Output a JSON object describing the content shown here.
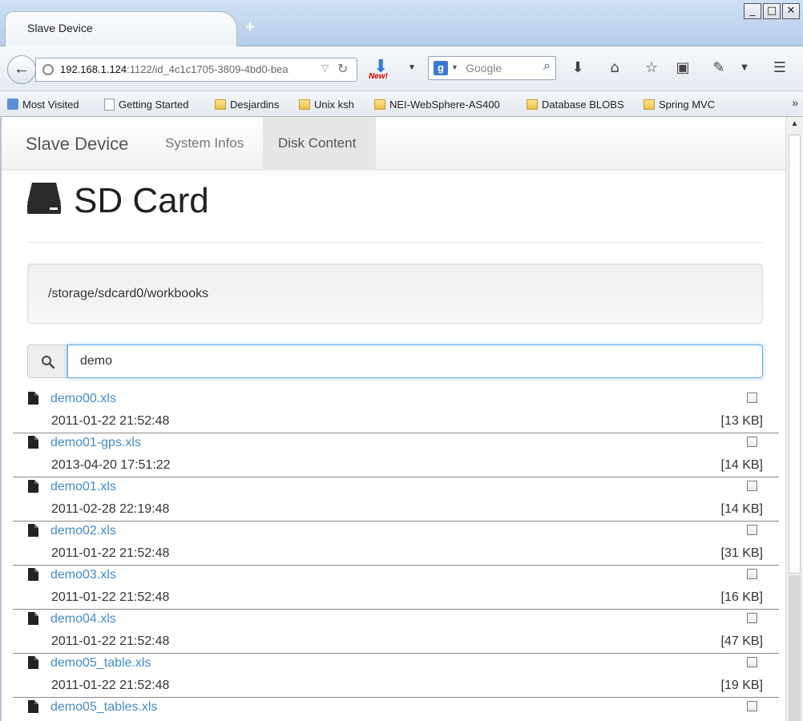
{
  "window": {
    "tab_title": "Slave Device",
    "new_tab": "+",
    "minimize": "_",
    "maximize": "□",
    "close": "✕"
  },
  "toolbar": {
    "url_host": "192.168.1.124",
    "url_rest": ":1122/id_4c1c1705-3809-4bd0-bea",
    "download_badge": "New!",
    "search_placeholder": "Google"
  },
  "bookmarks": [
    {
      "label": "Most Visited",
      "icon": "most-visited-icon"
    },
    {
      "label": "Getting Started",
      "icon": "page-icon"
    },
    {
      "label": "Desjardins",
      "icon": "folder-icon"
    },
    {
      "label": "Unix ksh",
      "icon": "folder-icon"
    },
    {
      "label": "NEI-WebSphere-AS400",
      "icon": "folder-icon"
    },
    {
      "label": "Database BLOBS",
      "icon": "folder-icon"
    },
    {
      "label": "Spring MVC",
      "icon": "folder-icon"
    }
  ],
  "app": {
    "brand": "Slave Device",
    "nav": [
      "System Infos",
      "Disk Content"
    ],
    "active_nav": "Disk Content",
    "header": "SD Card",
    "path": "/storage/sdcard0/workbooks",
    "search_value": "demo"
  },
  "files": [
    {
      "name": "demo00.xls",
      "date": "2011-01-22 21:52:48",
      "size": "[13 KB]"
    },
    {
      "name": "demo01-gps.xls",
      "date": "2013-04-20 17:51:22",
      "size": "[14 KB]"
    },
    {
      "name": "demo01.xls",
      "date": "2011-02-28 22:19:48",
      "size": "[14 KB]"
    },
    {
      "name": "demo02.xls",
      "date": "2011-01-22 21:52:48",
      "size": "[31 KB]"
    },
    {
      "name": "demo03.xls",
      "date": "2011-01-22 21:52:48",
      "size": "[16 KB]"
    },
    {
      "name": "demo04.xls",
      "date": "2011-01-22 21:52:48",
      "size": "[47 KB]"
    },
    {
      "name": "demo05_table.xls",
      "date": "2011-01-22 21:52:48",
      "size": "[19 KB]"
    },
    {
      "name": "demo05_tables.xls",
      "date": "",
      "size": ""
    }
  ],
  "colors": {
    "link": "#428bca",
    "focus": "#66afe9",
    "chrome": "#cfe0f4"
  }
}
